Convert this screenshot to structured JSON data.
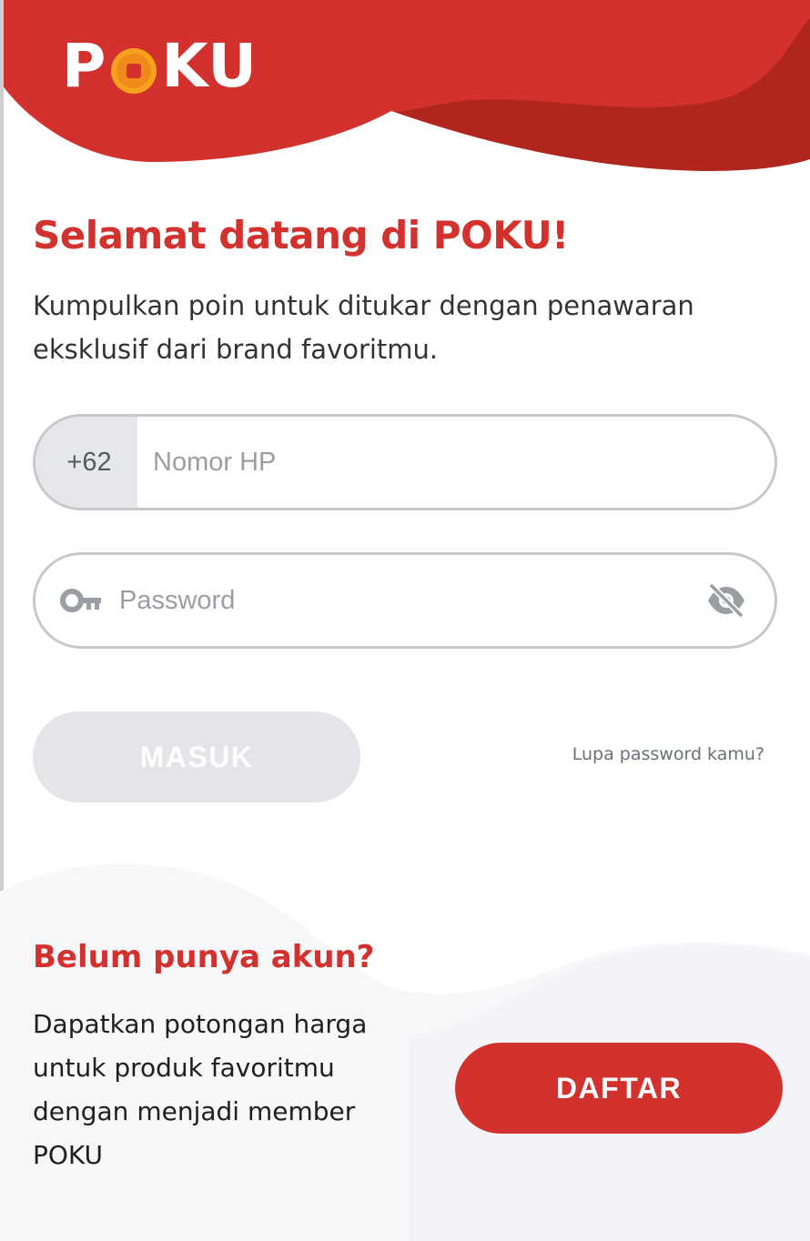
{
  "brand": {
    "logo_prefix": "P",
    "logo_suffix": "KU",
    "primary_color": "#d3312d"
  },
  "welcome": {
    "title": "Selamat datang di POKU!",
    "subtitle": "Kumpulkan poin untuk ditukar dengan penawaran eksklusif dari brand favoritmu."
  },
  "phone_field": {
    "prefix": "+62",
    "placeholder": "Nomor HP",
    "value": ""
  },
  "password_field": {
    "placeholder": "Password",
    "value": "",
    "icon": "key-icon",
    "toggle_icon": "eye-slash-icon"
  },
  "login": {
    "button_label": "MASUK",
    "forgot_link": "Lupa password kamu?"
  },
  "register": {
    "title": "Belum punya akun?",
    "description": "Dapatkan potongan harga untuk produk favoritmu dengan menjadi member POKU",
    "button_label": "DAFTAR"
  }
}
